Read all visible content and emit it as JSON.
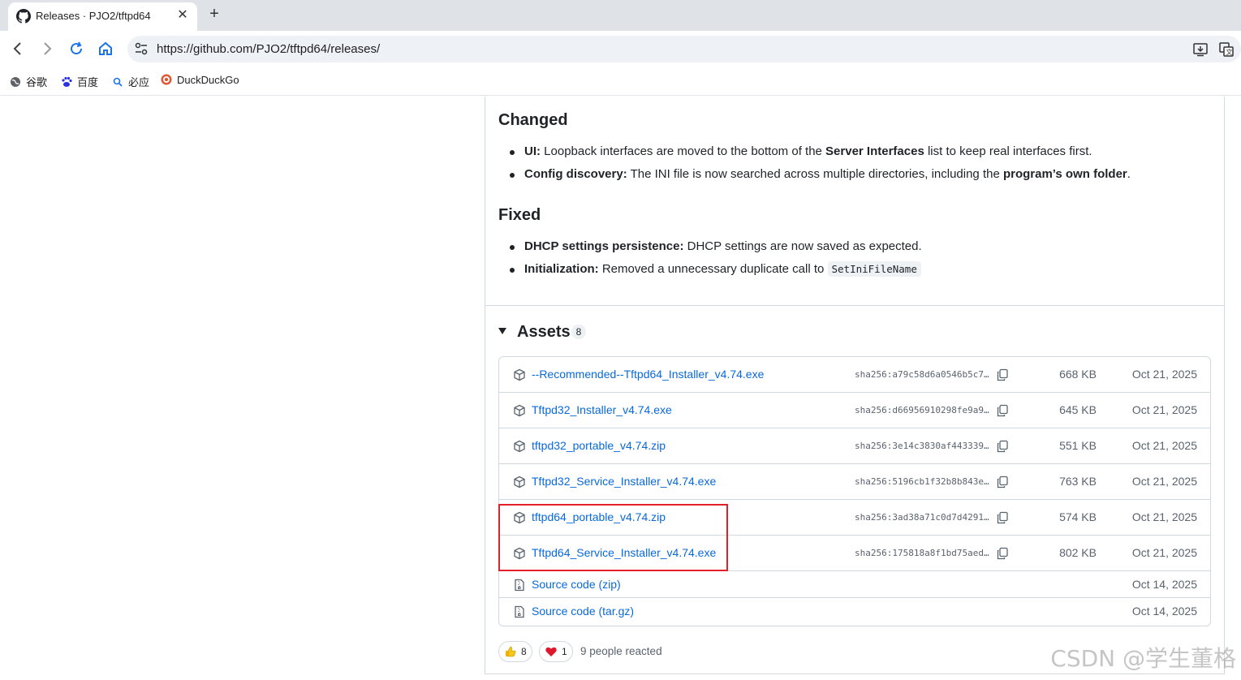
{
  "browser": {
    "tab_title": "Releases · PJO2/tftpd64",
    "url": "https://github.com/PJO2/tftpd64/releases/",
    "bookmarks": [
      {
        "label": "谷歌",
        "icon": "globe-icon"
      },
      {
        "label": "百度",
        "icon": "baidu-paw-icon"
      },
      {
        "label": "必应",
        "icon": "bing-search-icon"
      },
      {
        "label": "DuckDuckGo",
        "icon": "duckduckgo-icon"
      }
    ]
  },
  "notes": {
    "changed_heading": "Changed",
    "changed": [
      {
        "bold": "UI:",
        "text": " Loopback interfaces are moved to the bottom of the ",
        "bold2": "Server Interfaces",
        "text2": " list to keep real interfaces first."
      },
      {
        "bold": "Config discovery:",
        "text": " The INI file is now searched across multiple directories, including the ",
        "bold2": "program’s own folder",
        "text2": "."
      }
    ],
    "fixed_heading": "Fixed",
    "fixed": [
      {
        "bold": "DHCP settings persistence:",
        "text": " DHCP settings are now saved as expected."
      },
      {
        "bold": "Initialization:",
        "text": " Removed a unnecessary duplicate call to ",
        "code": "SetIniFileName"
      }
    ]
  },
  "assets": {
    "title": "Assets",
    "count": "8",
    "items": [
      {
        "name": "--Recommended--Tftpd64_Installer_v4.74.exe",
        "sha": "sha256:a79c58d6a0546b5c7…",
        "size": "668 KB",
        "date": "Oct 21, 2025"
      },
      {
        "name": "Tftpd32_Installer_v4.74.exe",
        "sha": "sha256:d66956910298fe9a9…",
        "size": "645 KB",
        "date": "Oct 21, 2025"
      },
      {
        "name": "tftpd32_portable_v4.74.zip",
        "sha": "sha256:3e14c3830af443339…",
        "size": "551 KB",
        "date": "Oct 21, 2025"
      },
      {
        "name": "Tftpd32_Service_Installer_v4.74.exe",
        "sha": "sha256:5196cb1f32b8b843e…",
        "size": "763 KB",
        "date": "Oct 21, 2025"
      },
      {
        "name": "tftpd64_portable_v4.74.zip",
        "sha": "sha256:3ad38a71c0d7d4291…",
        "size": "574 KB",
        "date": "Oct 21, 2025"
      },
      {
        "name": "Tftpd64_Service_Installer_v4.74.exe",
        "sha": "sha256:175818a8f1bd75aed…",
        "size": "802 KB",
        "date": "Oct 21, 2025"
      }
    ],
    "sources": [
      {
        "name": "Source code",
        "ext": "(zip)",
        "date": "Oct 14, 2025"
      },
      {
        "name": "Source code",
        "ext": "(tar.gz)",
        "date": "Oct 14, 2025"
      }
    ]
  },
  "reactions": {
    "thumbs_up": "8",
    "heart": "1",
    "summary": "9 people reacted"
  },
  "watermark": "CSDN @学生董格"
}
